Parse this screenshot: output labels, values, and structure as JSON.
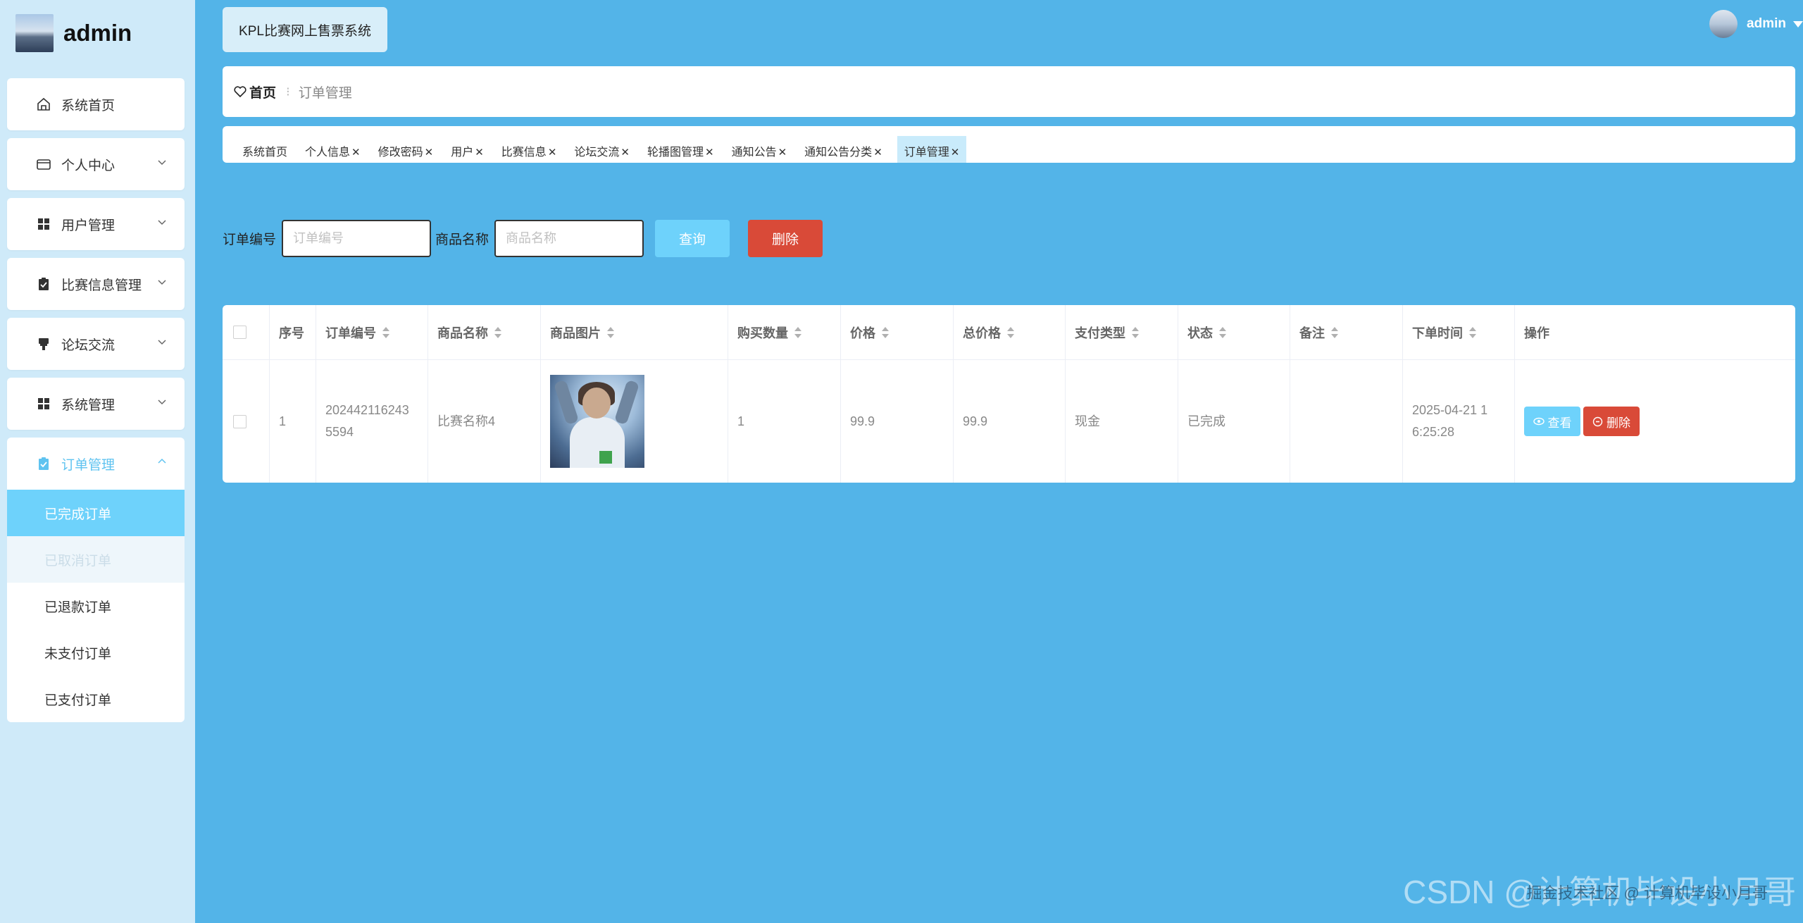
{
  "brand": {
    "name": "admin"
  },
  "sidebar": {
    "items": [
      {
        "label": "系统首页",
        "icon": "home-icon",
        "expandable": false
      },
      {
        "label": "个人中心",
        "icon": "wallet-icon",
        "expandable": true
      },
      {
        "label": "用户管理",
        "icon": "grid-icon",
        "expandable": true
      },
      {
        "label": "比赛信息管理",
        "icon": "clipboard-icon",
        "expandable": true
      },
      {
        "label": "论坛交流",
        "icon": "brush-icon",
        "expandable": true
      },
      {
        "label": "系统管理",
        "icon": "grid-icon",
        "expandable": true
      }
    ],
    "order_group": {
      "label": "订单管理",
      "icon": "clipboard-icon",
      "sub_items": [
        "已完成订单",
        "已取消订单",
        "已退款订单",
        "未支付订单",
        "已支付订单"
      ]
    }
  },
  "header": {
    "system_title": "KPL比赛网上售票系统",
    "user_name": "admin"
  },
  "breadcrumb": {
    "home": "首页",
    "separator": "⁝",
    "current": "订单管理"
  },
  "tabs": [
    {
      "label": "系统首页",
      "closable": false
    },
    {
      "label": "个人信息",
      "closable": true
    },
    {
      "label": "修改密码",
      "closable": true
    },
    {
      "label": "用户",
      "closable": true
    },
    {
      "label": "比赛信息",
      "closable": true
    },
    {
      "label": "论坛交流",
      "closable": true
    },
    {
      "label": "轮播图管理",
      "closable": true
    },
    {
      "label": "通知公告",
      "closable": true
    },
    {
      "label": "通知公告分类",
      "closable": true
    },
    {
      "label": "订单管理",
      "closable": true,
      "active": true
    }
  ],
  "search": {
    "order_no_label": "订单编号",
    "order_no_placeholder": "订单编号",
    "product_name_label": "商品名称",
    "product_name_placeholder": "商品名称",
    "query_button": "查询",
    "delete_button": "删除"
  },
  "table": {
    "columns": [
      "序号",
      "订单编号",
      "商品名称",
      "商品图片",
      "购买数量",
      "价格",
      "总价格",
      "支付类型",
      "状态",
      "备注",
      "下单时间",
      "操作"
    ],
    "rows": [
      {
        "index": "1",
        "order_no_line1": "202442116243",
        "order_no_line2": "5594",
        "product_name": "比赛名称4",
        "quantity": "1",
        "price": "99.9",
        "total": "99.9",
        "pay_type": "现金",
        "status": "已完成",
        "remark": "",
        "time_line1": "2025-04-21 1",
        "time_line2": "6:25:28",
        "view_button": "查看",
        "delete_button": "删除"
      }
    ]
  },
  "watermark": {
    "main": "CSDN @计算机毕设小月哥",
    "sub": "掘金技术社区 @ 计算机毕设小月哥"
  },
  "colors": {
    "background": "#53b4e8",
    "sidebar": "#cfeaf9",
    "accent": "#6ed2fb",
    "danger": "#d94a38"
  }
}
